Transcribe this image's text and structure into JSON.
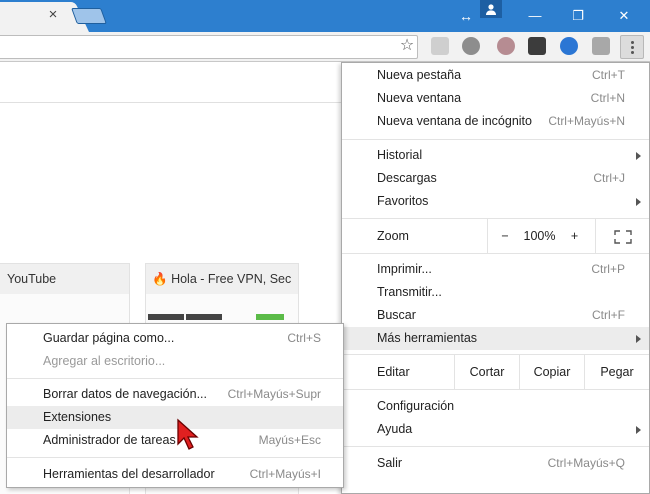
{
  "colors": {
    "titlebar": "#2d7fcf",
    "menu_highlight": "#ececec",
    "cursor": "#e02020"
  },
  "titlebar": {
    "tab_close_glyph": "×",
    "restore_glyph": "↔",
    "minimize_glyph": "—",
    "maximize_glyph": "❐",
    "close_glyph": "✕"
  },
  "toolbar": {
    "star_glyph": "☆"
  },
  "tiles": [
    {
      "title": "YouTube"
    },
    {
      "title": "Hola - Free VPN, Sec"
    }
  ],
  "menu": {
    "new_tab": {
      "label": "Nueva pestaña",
      "shortcut": "Ctrl+T"
    },
    "new_window": {
      "label": "Nueva ventana",
      "shortcut": "Ctrl+N"
    },
    "incognito": {
      "label": "Nueva ventana de incógnito",
      "shortcut": "Ctrl+Mayús+N"
    },
    "history": {
      "label": "Historial"
    },
    "downloads": {
      "label": "Descargas",
      "shortcut": "Ctrl+J"
    },
    "bookmarks": {
      "label": "Favoritos"
    },
    "zoom": {
      "label": "Zoom",
      "minus": "−",
      "value": "100%",
      "plus": "+"
    },
    "print": {
      "label": "Imprimir...",
      "shortcut": "Ctrl+P"
    },
    "cast": {
      "label": "Transmitir..."
    },
    "find": {
      "label": "Buscar",
      "shortcut": "Ctrl+F"
    },
    "more_tools": {
      "label": "Más herramientas"
    },
    "edit": {
      "label": "Editar",
      "cut": "Cortar",
      "copy": "Copiar",
      "paste": "Pegar"
    },
    "settings": {
      "label": "Configuración"
    },
    "help": {
      "label": "Ayuda"
    },
    "exit": {
      "label": "Salir",
      "shortcut": "Ctrl+Mayús+Q"
    }
  },
  "submenu": {
    "save_page": {
      "label": "Guardar página como...",
      "shortcut": "Ctrl+S"
    },
    "add_desktop": {
      "label": "Agregar al escritorio..."
    },
    "clear_data": {
      "label": "Borrar datos de navegación...",
      "shortcut": "Ctrl+Mayús+Supr"
    },
    "extensions": {
      "label": "Extensiones"
    },
    "task_manager": {
      "label": "Administrador de tareas",
      "shortcut": "Mayús+Esc"
    },
    "dev_tools": {
      "label": "Herramientas del desarrollador",
      "shortcut": "Ctrl+Mayús+I"
    }
  }
}
